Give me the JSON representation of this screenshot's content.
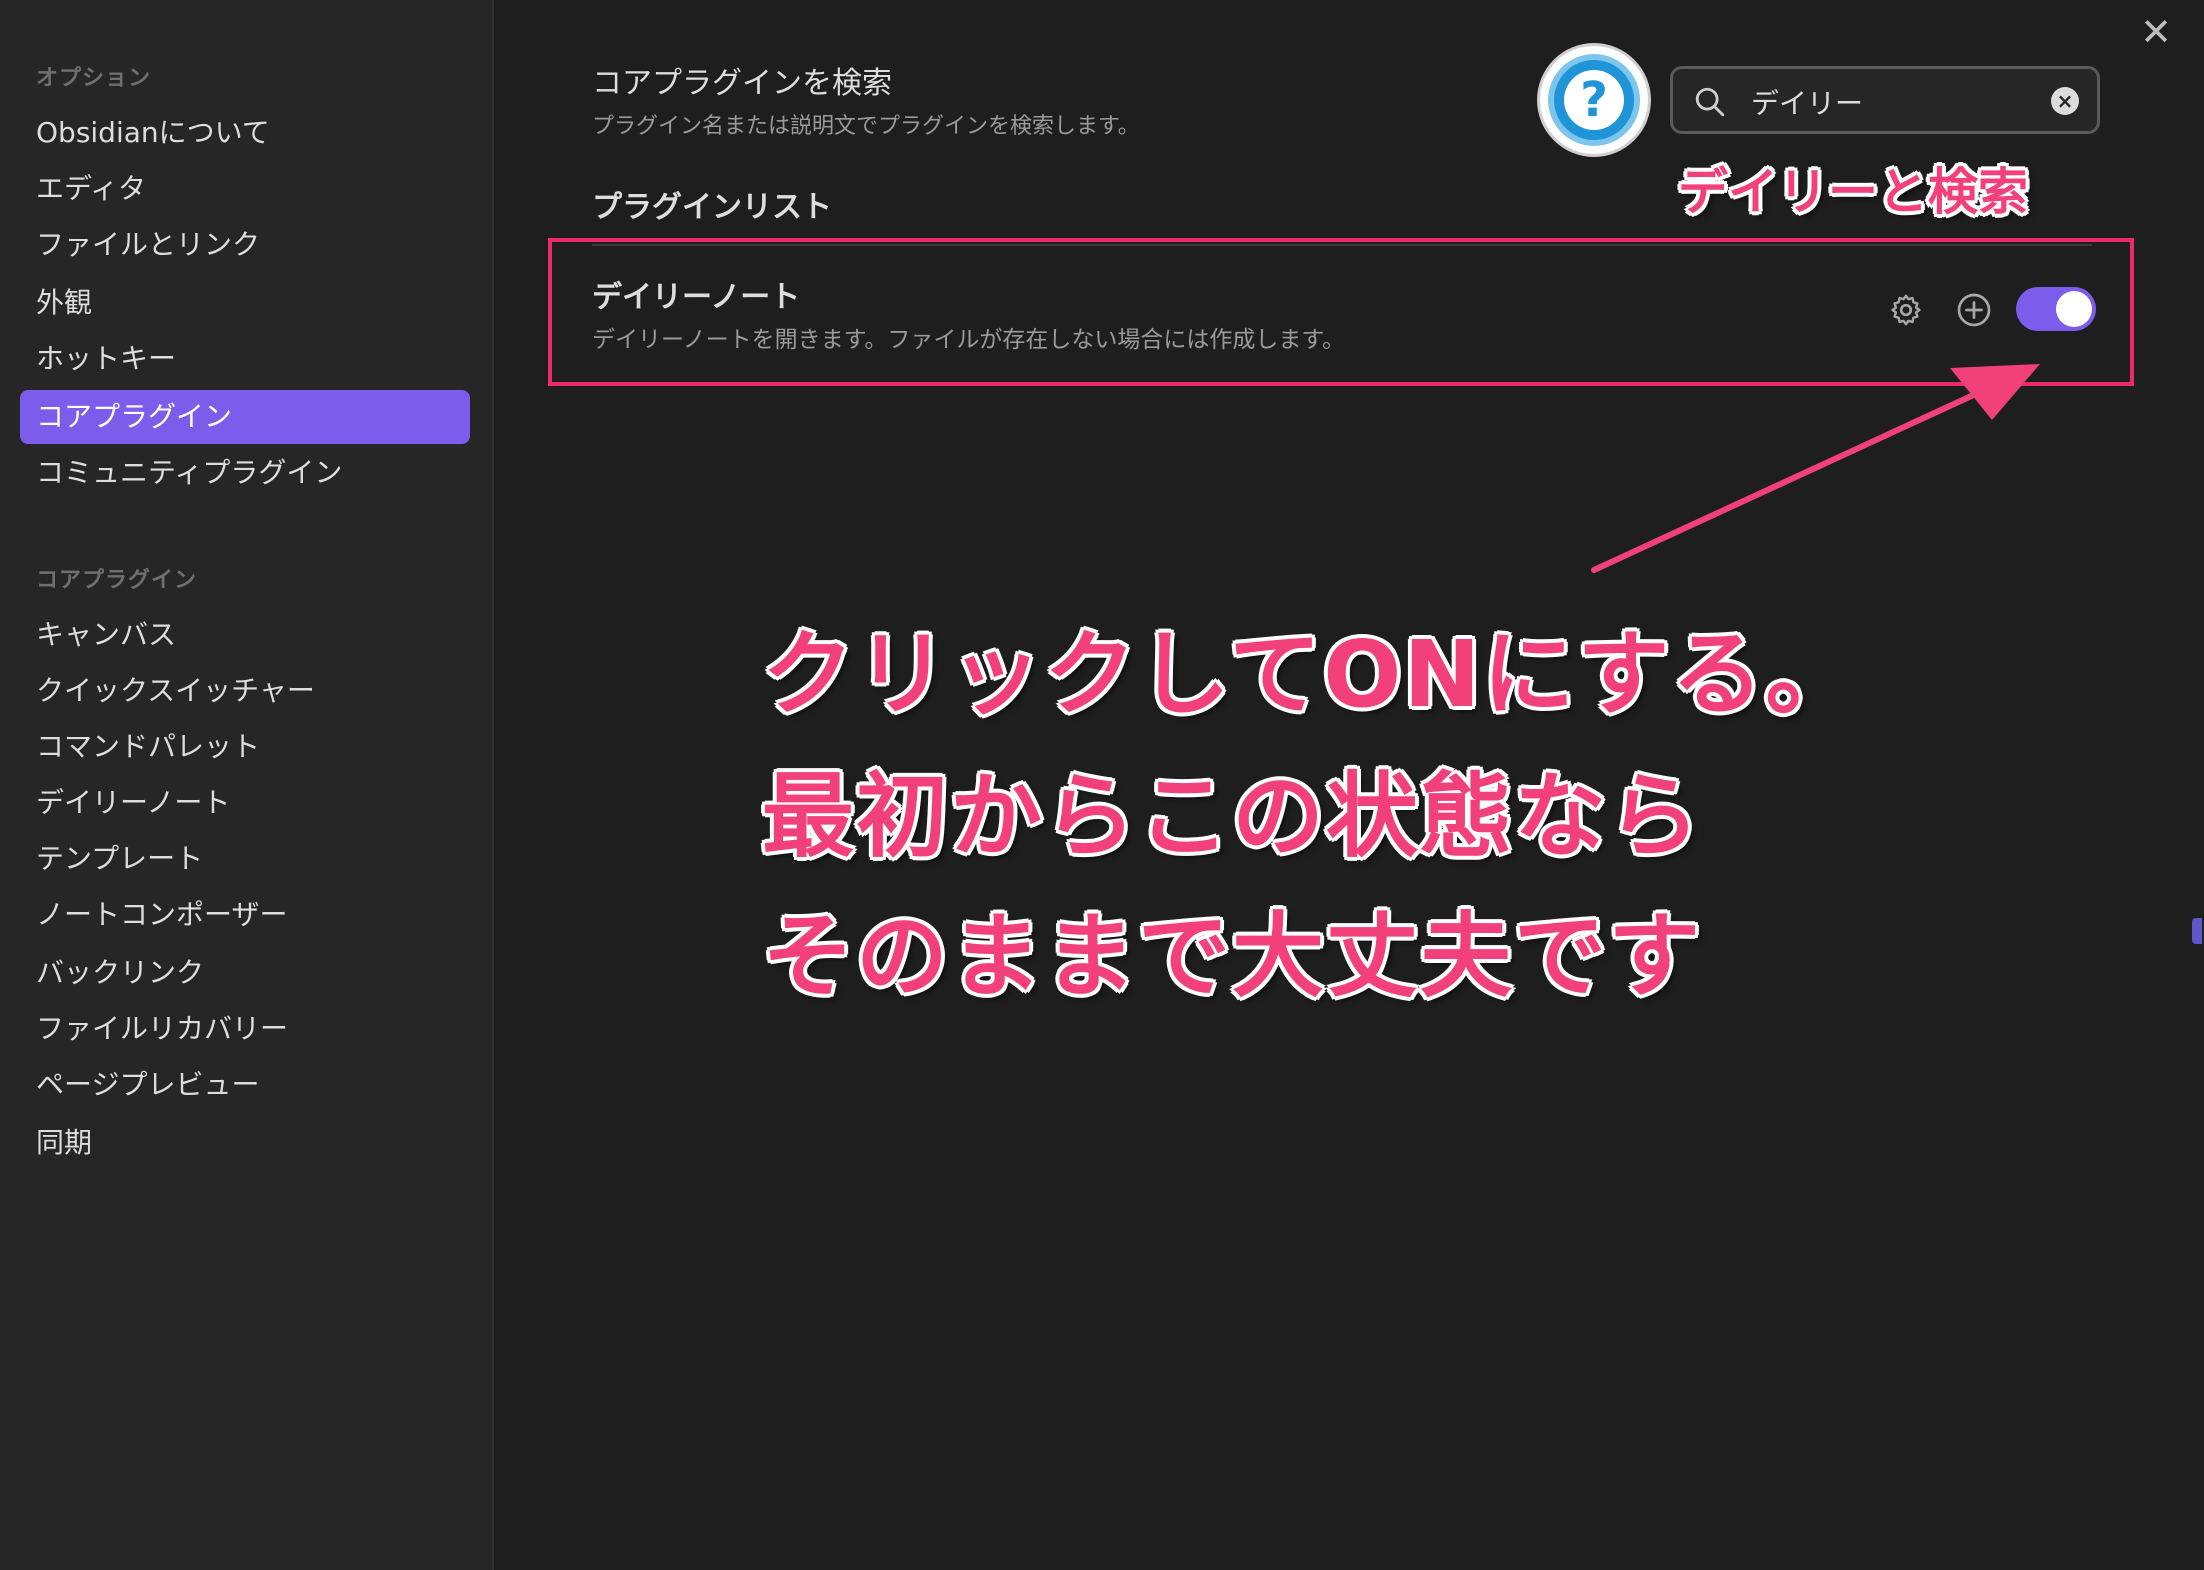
{
  "sidebar": {
    "section_options": "オプション",
    "options_items": [
      "Obsidianについて",
      "エディタ",
      "ファイルとリンク",
      "外観",
      "ホットキー",
      "コアプラグイン",
      "コミュニティプラグイン"
    ],
    "section_core": "コアプラグイン",
    "core_items": [
      "キャンバス",
      "クイックスイッチャー",
      "コマンドパレット",
      "デイリーノート",
      "テンプレート",
      "ノートコンポーザー",
      "バックリンク",
      "ファイルリカバリー",
      "ページプレビュー",
      "同期"
    ],
    "active_item": "コアプラグイン"
  },
  "header": {
    "search_title": "コアプラグインを検索",
    "search_desc": "プラグイン名または説明文でプラグインを検索します。",
    "search_value": "デイリー",
    "help_glyph": "?",
    "close_glyph": "✕"
  },
  "plugins": {
    "list_heading": "プラグインリスト",
    "items": [
      {
        "name": "デイリーノート",
        "description": "デイリーノートを開きます。ファイルが存在しない場合には作成します。",
        "enabled": true
      }
    ]
  },
  "annotations": {
    "search_hint": "デイリーと検索",
    "line1": "クリックしてONにする。",
    "line2": "最初からこの状態なら",
    "line3": "そのままで大丈夫です"
  },
  "colors": {
    "accent": "#7c5cea",
    "annotation": "#f2407a",
    "highlight_border": "#ea2a6b",
    "help_blue": "#1f95d8"
  }
}
